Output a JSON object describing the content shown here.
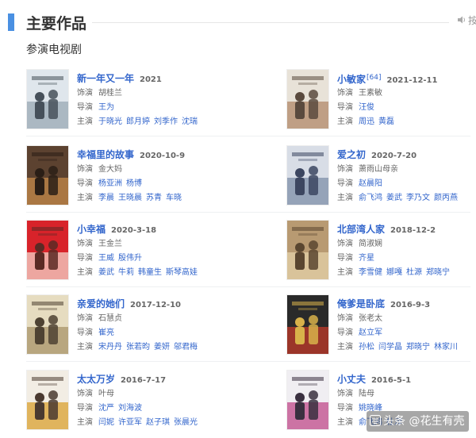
{
  "section": {
    "title": "主要作品",
    "action_label": "按",
    "subtitle": "参演电视剧"
  },
  "labels": {
    "role": "饰演",
    "director": "导演",
    "cast": "主演"
  },
  "works": [
    {
      "title": "新一年又一年",
      "sup": "",
      "date": "2021",
      "role": "胡桂兰",
      "directors": [
        "王为"
      ],
      "cast": [
        "于晓光",
        "郎月婷",
        "刘季作",
        "沈瑞"
      ],
      "poster_colors": [
        "#dfe6ec",
        "#9aa8b4",
        "#46505a"
      ]
    },
    {
      "title": "小敏家",
      "sup": "[64]",
      "date": "2021-12-11",
      "role": "王素敏",
      "directors": [
        "汪俊"
      ],
      "cast": [
        "周迅",
        "黄磊"
      ],
      "poster_colors": [
        "#e8e2d8",
        "#b2886a",
        "#5a4a3e"
      ]
    },
    {
      "title": "幸福里的故事",
      "sup": "",
      "date": "2020-10-9",
      "role": "金大妈",
      "directors": [
        "杨亚洲",
        "杨博"
      ],
      "cast": [
        "李晨",
        "王晓晨",
        "苏青",
        "车晓"
      ],
      "poster_colors": [
        "#5c4230",
        "#c4894a",
        "#2a1e16"
      ]
    },
    {
      "title": "爱之初",
      "sup": "",
      "date": "2020-7-20",
      "role": "萧雨山母亲",
      "directors": [
        "赵晨阳"
      ],
      "cast": [
        "俞飞鸿",
        "姜武",
        "李乃文",
        "颜丙燕"
      ],
      "poster_colors": [
        "#d8dde6",
        "#7f8fa8",
        "#3c4660"
      ]
    },
    {
      "title": "小幸福",
      "sup": "",
      "date": "2020-3-18",
      "role": "王金兰",
      "directors": [
        "王威",
        "殷伟升"
      ],
      "cast": [
        "姜武",
        "牛莉",
        "韩童生",
        "斯琴高娃"
      ],
      "poster_colors": [
        "#d8232a",
        "#f4d3c8",
        "#5a2a24"
      ]
    },
    {
      "title": "北部湾人家",
      "sup": "",
      "date": "2018-12-2",
      "role": "简淑娴",
      "directors": [
        "齐星"
      ],
      "cast": [
        "李雪健",
        "娜嘎",
        "杜源",
        "郑晓宁"
      ],
      "poster_colors": [
        "#b89a72",
        "#e4d0a8",
        "#5a4630"
      ]
    },
    {
      "title": "亲爱的她们",
      "sup": "",
      "date": "2017-12-10",
      "role": "石慧贞",
      "directors": [
        "崔亮"
      ],
      "cast": [
        "宋丹丹",
        "张若昀",
        "姜妍",
        "邬君梅"
      ],
      "poster_colors": [
        "#e6dcc0",
        "#a8946a",
        "#4e4232"
      ]
    },
    {
      "title": "俺爹是卧底",
      "sup": "",
      "date": "2016-9-3",
      "role": "张老太",
      "directors": [
        "赵立军"
      ],
      "cast": [
        "孙松",
        "闫学晶",
        "郑晓宁",
        "林家川"
      ],
      "poster_colors": [
        "#2a2a2a",
        "#c23a2a",
        "#d8b24a"
      ]
    },
    {
      "title": "太太万岁",
      "sup": "",
      "date": "2016-7-17",
      "role": "叶母",
      "directors": [
        "沈严",
        "刘海波"
      ],
      "cast": [
        "闫妮",
        "许亚军",
        "赵子琪",
        "张晨光"
      ],
      "poster_colors": [
        "#f2ede4",
        "#d9a030",
        "#4a3a30"
      ]
    },
    {
      "title": "小丈夫",
      "sup": "",
      "date": "2016-5-1",
      "role": "陆母",
      "directors": [
        "姚晓峰"
      ],
      "cast": [
        "俞飞鸿",
        "杜淳"
      ],
      "poster_colors": [
        "#f0eef2",
        "#c04a8a",
        "#3a3040"
      ]
    }
  ],
  "watermark": "头条 @花生有壳"
}
